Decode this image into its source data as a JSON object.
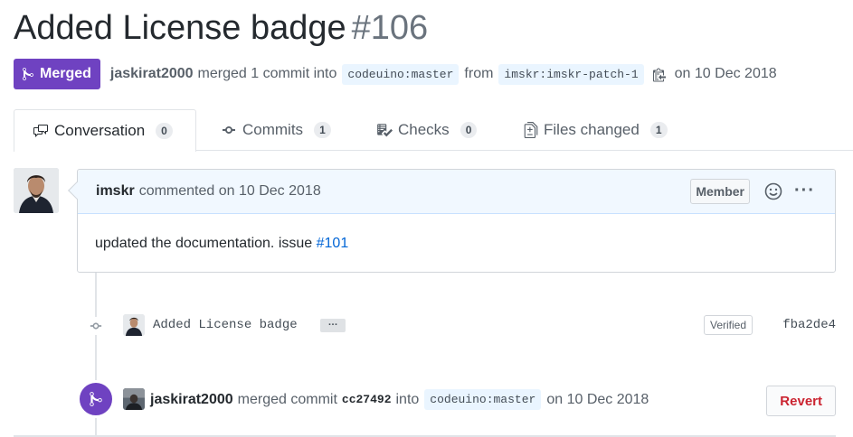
{
  "pr": {
    "title": "Added License badge",
    "number": "#106",
    "state": "Merged",
    "author": "jaskirat2000",
    "merged_text": "merged 1 commit into",
    "base_branch": "codeuino:master",
    "from_text": "from",
    "head_branch": "imskr:imskr-patch-1",
    "date_text": "on 10 Dec 2018"
  },
  "tabs": [
    {
      "label": "Conversation",
      "count": "0",
      "icon": "comment-discussion-icon",
      "selected": true
    },
    {
      "label": "Commits",
      "count": "1",
      "icon": "git-commit-icon"
    },
    {
      "label": "Checks",
      "count": "0",
      "icon": "checklist-icon"
    },
    {
      "label": "Files changed",
      "count": "1",
      "icon": "diff-icon"
    }
  ],
  "comment": {
    "author": "imskr",
    "action": "commented on 10 Dec 2018",
    "role": "Member",
    "body_text": "updated the documentation. issue",
    "issue_link": "#101"
  },
  "commit": {
    "message": "Added License badge",
    "ellipsis": "…",
    "verified": "Verified",
    "sha": "fba2de4"
  },
  "merge_event": {
    "author": "jaskirat2000",
    "text": "merged commit",
    "sha": "cc27492",
    "into": "into",
    "branch": "codeuino:master",
    "date": "on 10 Dec 2018",
    "revert": "Revert"
  },
  "colors": {
    "merged": "#6f42c1",
    "link": "#0366d6",
    "revert": "#cb2431",
    "comment_header": "#f1f8ff"
  }
}
